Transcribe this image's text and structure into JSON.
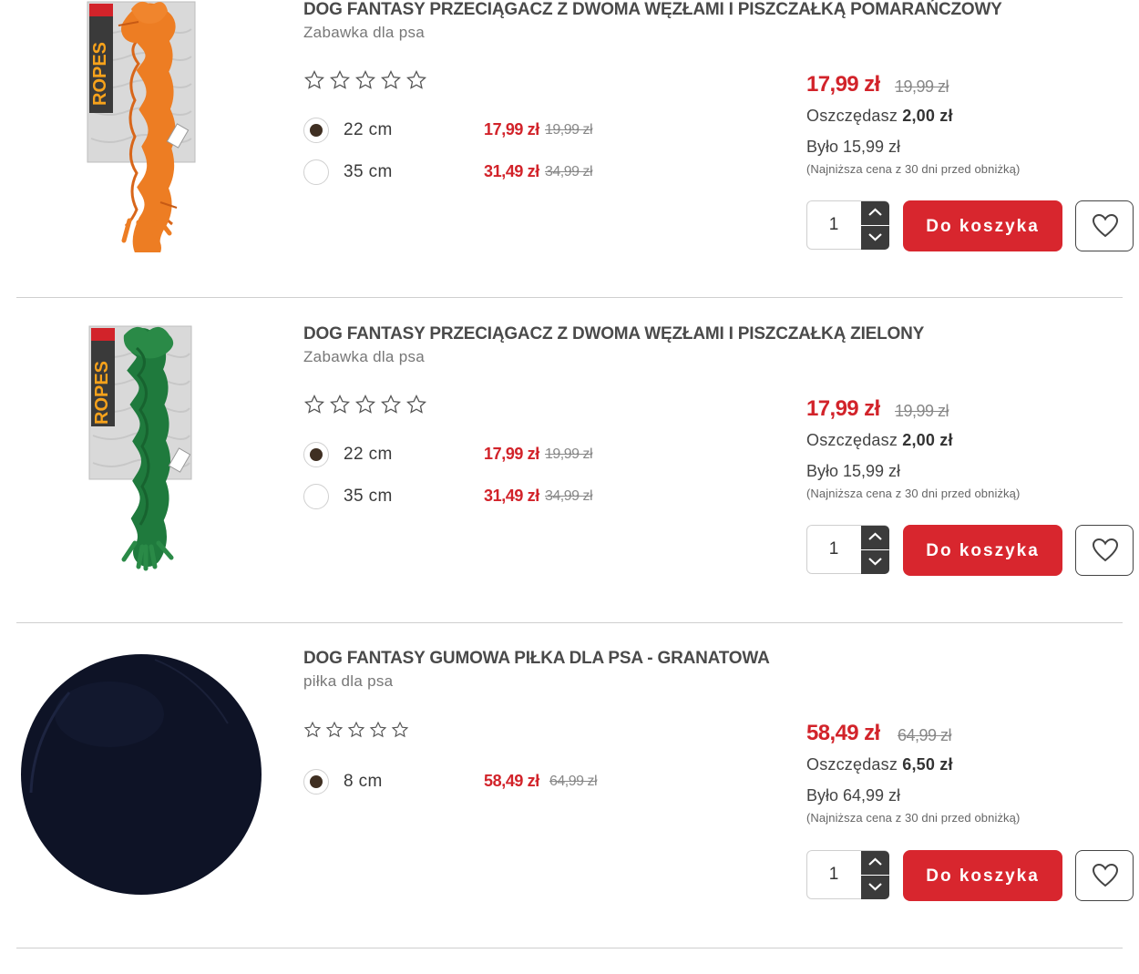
{
  "products": [
    {
      "title": "DOG FANTASY PRZECIĄGACZ Z DWOMA WĘZŁAMI I PISZCZAŁKĄ POMARAŃCZOWY",
      "subtitle": "Zabawka dla psa",
      "image_icon": "orange-rope-toy",
      "rating_stars": 0,
      "variants": [
        {
          "size": "22 cm",
          "price": "17,99 zł",
          "old_price": "19,99 zł",
          "selected": true
        },
        {
          "size": "35 cm",
          "price": "31,49 zł",
          "old_price": "34,99 zł",
          "selected": false
        }
      ],
      "price": "17,99 zł",
      "old_price": "19,99 zł",
      "save_label": "Oszczędasz",
      "save_amount": "2,00 zł",
      "was": "Było 15,99 zł",
      "lowest_note": "(Najniższa cena z 30 dni przed obniżką)",
      "quantity": "1",
      "cart_label": "Do koszyka"
    },
    {
      "title": "DOG FANTASY PRZECIĄGACZ Z DWOMA WĘZŁAMI I PISZCZAŁKĄ ZIELONY",
      "subtitle": "Zabawka dla psa",
      "image_icon": "green-rope-toy",
      "rating_stars": 0,
      "variants": [
        {
          "size": "22 cm",
          "price": "17,99 zł",
          "old_price": "19,99 zł",
          "selected": true
        },
        {
          "size": "35 cm",
          "price": "31,49 zł",
          "old_price": "34,99 zł",
          "selected": false
        }
      ],
      "price": "17,99 zł",
      "old_price": "19,99 zł",
      "save_label": "Oszczędasz",
      "save_amount": "2,00 zł",
      "was": "Było 15,99 zł",
      "lowest_note": "(Najniższa cena z 30 dni przed obniżką)",
      "quantity": "1",
      "cart_label": "Do koszyka"
    },
    {
      "title": "DOG FANTASY GUMOWA PIŁKA DLA PSA - GRANATOWA",
      "subtitle": "piłka dla psa",
      "image_icon": "navy-rubber-ball",
      "rating_stars": 0,
      "variants": [
        {
          "size": "8 cm",
          "price": "58,49 zł",
          "old_price": "64,99 zł",
          "selected": true
        }
      ],
      "price": "58,49 zł",
      "old_price": "64,99 zł",
      "save_label": "Oszczędasz",
      "save_amount": "6,50 zł",
      "was": "Było 64,99 zł",
      "lowest_note": "(Najniższa cena z 30 dni przed obniżką)",
      "quantity": "1",
      "cart_label": "Do koszyka"
    }
  ],
  "colors": {
    "accent_red": "#d8262e",
    "price_red": "#d2232a",
    "stepper_dark": "#3b3b3b",
    "radio_selected": "#3f2f22"
  }
}
